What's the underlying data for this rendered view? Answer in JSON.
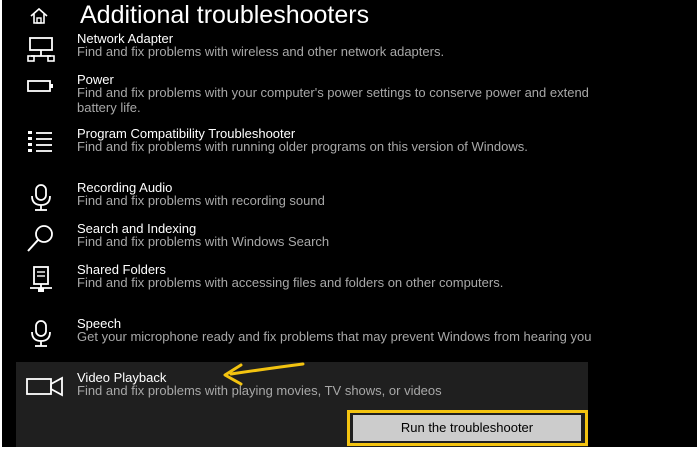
{
  "page": {
    "title": "Additional troubleshooters",
    "home_icon": "home-icon"
  },
  "colors": {
    "background": "#000000",
    "selected_panel": "#1f1f1f",
    "text_primary": "#ffffff",
    "text_secondary": "#a8a8a8",
    "button_bg": "#cccccc",
    "highlight": "#f3c310",
    "arrow": "#f3c310"
  },
  "items": [
    {
      "name": "Network Adapter",
      "desc": "Find and fix problems with wireless and other network adapters.",
      "icon": "network-adapter-icon"
    },
    {
      "name": "Power",
      "desc": "Find and fix problems with your computer's power settings to conserve power and extend battery life.",
      "icon": "battery-icon"
    },
    {
      "name": "Program Compatibility Troubleshooter",
      "desc": "Find and fix problems with running older programs on this version of Windows.",
      "icon": "program-list-icon"
    },
    {
      "name": "Recording Audio",
      "desc": "Find and fix problems with recording sound",
      "icon": "microphone-icon"
    },
    {
      "name": "Search and Indexing",
      "desc": "Find and fix problems with Windows Search",
      "icon": "search-icon"
    },
    {
      "name": "Shared Folders",
      "desc": "Find and fix problems with accessing files and folders on other computers.",
      "icon": "shared-folder-icon"
    },
    {
      "name": "Speech",
      "desc": "Get your microphone ready and fix problems that may prevent Windows from hearing you",
      "icon": "microphone-icon"
    },
    {
      "name": "Video Playback",
      "desc": "Find and fix problems with playing movies, TV shows, or videos",
      "icon": "video-camera-icon"
    }
  ],
  "run_button": {
    "label": "Run the troubleshooter"
  }
}
